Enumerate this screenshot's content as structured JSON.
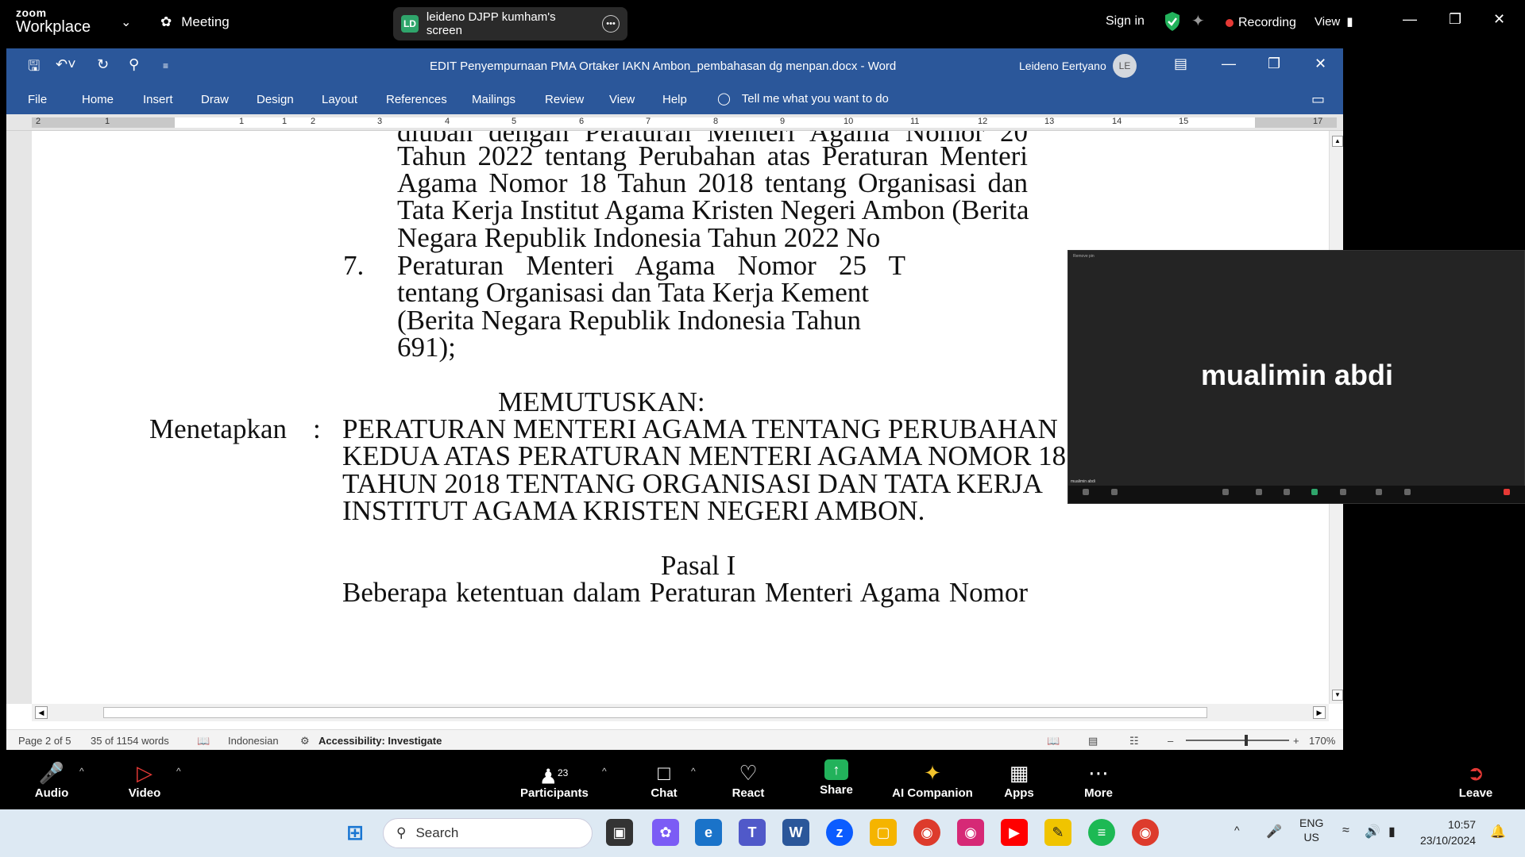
{
  "zoom_top": {
    "brand_line1": "zoom",
    "brand_line2": "Workplace",
    "meeting_label": "Meeting",
    "share_badge": "LD",
    "share_label": "leideno DJPP kumham's screen",
    "sign_in": "Sign in",
    "recording": "Recording",
    "view": "View"
  },
  "word": {
    "doc_title": "EDIT Penyempurnaan PMA Ortaker IAKN Ambon_pembahasan dg menpan.docx  -  Word",
    "user_name": "Leideno Eertyano",
    "user_initials": "LE",
    "menu": [
      "File",
      "Home",
      "Insert",
      "Draw",
      "Design",
      "Layout",
      "References",
      "Mailings",
      "Review",
      "View",
      "Help"
    ],
    "tell_me": "Tell me what you want to do",
    "ruler_numbers": [
      "2",
      "1",
      "1",
      "1",
      "2",
      "3",
      "4",
      "5",
      "6",
      "7",
      "8",
      "9",
      "10",
      "11",
      "12",
      "13",
      "14",
      "15",
      "17"
    ],
    "body": {
      "cut_line": "diubah dengan Peraturan Menteri Agama Nomor 20",
      "para6": [
        "Tahun 2022 tentang Perubahan atas Peraturan Menteri",
        "Agama Nomor 18 Tahun 2018 tentang Organisasi dan",
        "Tata Kerja Institut Agama Kristen Negeri Ambon (Berita",
        "Negara Republik Indonesia Tahun 2022 No"
      ],
      "item7_num": "7.",
      "item7": [
        "Peraturan Menteri Agama Nomor 25 T",
        "tentang Organisasi dan Tata Kerja Kement",
        "(Berita Negara Republik Indonesia Tahun",
        "691);"
      ],
      "memutuskan": "MEMUTUSKAN:",
      "menetapkan": "Menetapkan",
      "colon": ":",
      "decision": [
        "PERATURAN MENTERI AGAMA TENTANG PERUBAHAN",
        "KEDUA ATAS PERATURAN MENTERI AGAMA NOMOR 18",
        "TAHUN 2018 TENTANG ORGANISASI DAN TATA KERJA",
        "INSTITUT AGAMA KRISTEN NEGERI AMBON."
      ],
      "pasal": "Pasal I",
      "cut_bottom": "Beberapa ketentuan dalam Peraturan Menteri Agama Nomor"
    },
    "status": {
      "page": "Page 2 of 5",
      "words": "35 of 1154 words",
      "language": "Indonesian",
      "accessibility": "Accessibility: Investigate",
      "zoom": "170%"
    }
  },
  "participant": {
    "name": "mualimin abdi",
    "mini_label": "mualimin abdi",
    "mini_top": "Remove pin"
  },
  "zoom_bottom": {
    "audio": "Audio",
    "video": "Video",
    "participants": "Participants",
    "participants_count": "23",
    "chat": "Chat",
    "react": "React",
    "share": "Share",
    "ai": "AI Companion",
    "apps": "Apps",
    "more": "More",
    "leave": "Leave"
  },
  "taskbar": {
    "search": "Search",
    "lang_top": "ENG",
    "lang_bottom": "US",
    "time": "10:57",
    "date": "23/10/2024"
  }
}
